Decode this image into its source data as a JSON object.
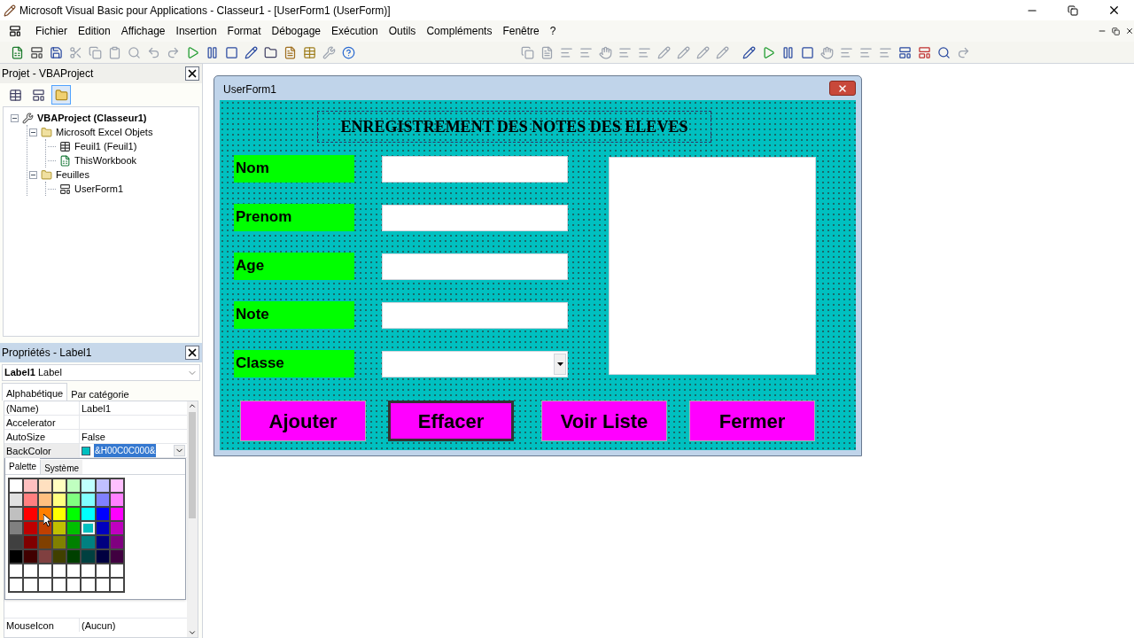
{
  "window": {
    "title": "Microsoft Visual Basic pour Applications - Classeur1 - [UserForm1 (UserForm)]"
  },
  "menu": [
    "Fichier",
    "Edition",
    "Affichage",
    "Insertion",
    "Format",
    "Débogage",
    "Exécution",
    "Outils",
    "Compléments",
    "Fenêtre",
    "?"
  ],
  "project_pane": {
    "title": "Projet - VBAProject",
    "tree": [
      {
        "label": "VBAProject (Classeur1)",
        "kind": "project",
        "expanded": true,
        "children": [
          {
            "label": "Microsoft Excel Objets",
            "kind": "folder",
            "expanded": true,
            "children": [
              {
                "label": "Feuil1 (Feuil1)",
                "kind": "sheet"
              },
              {
                "label": "ThisWorkbook",
                "kind": "workbook"
              }
            ]
          },
          {
            "label": "Feuilles",
            "kind": "folder",
            "expanded": true,
            "children": [
              {
                "label": "UserForm1",
                "kind": "form"
              }
            ]
          }
        ]
      }
    ]
  },
  "properties_pane": {
    "title": "Propriétés - Label1",
    "object": "Label1",
    "object_type": "Label",
    "tabs": [
      {
        "label": "Alphabétique",
        "selected": true
      },
      {
        "label": "Par catégorie",
        "selected": false
      }
    ],
    "rows": [
      {
        "name": "(Name)",
        "value": "Label1"
      },
      {
        "name": "Accelerator"
      },
      {
        "name": "AutoSize",
        "value": "False"
      },
      {
        "name": "BackColor",
        "value": "&H00C0C000&",
        "kind": "color",
        "color": "#00c0c0"
      }
    ],
    "rows_below": [
      {
        "name": "MouseIcon",
        "value": "(Aucun)"
      }
    ],
    "palette": {
      "tabs": [
        {
          "label": "Palette",
          "selected": true
        },
        {
          "label": "Système",
          "selected": false
        }
      ],
      "swatches": [
        {
          "color": "#ffffff",
          "selected": false
        },
        {
          "color": "#ffc0c0",
          "selected": false
        },
        {
          "color": "#ffe0c0",
          "selected": false
        },
        {
          "color": "#ffffc0",
          "selected": false
        },
        {
          "color": "#c0ffc0",
          "selected": false
        },
        {
          "color": "#c0ffff",
          "selected": false
        },
        {
          "color": "#c0c0ff",
          "selected": false
        },
        {
          "color": "#ffc0ff",
          "selected": false
        },
        {
          "color": "#e0e0e0",
          "selected": false
        },
        {
          "color": "#ff8080",
          "selected": false
        },
        {
          "color": "#ffc080",
          "selected": false
        },
        {
          "color": "#ffff80",
          "selected": false
        },
        {
          "color": "#80ff80",
          "selected": false
        },
        {
          "color": "#80ffff",
          "selected": false
        },
        {
          "color": "#8080ff",
          "selected": false
        },
        {
          "color": "#ff80ff",
          "selected": false
        },
        {
          "color": "#c0c0c0",
          "selected": false
        },
        {
          "color": "#ff0000",
          "selected": false
        },
        {
          "color": "#ff8000",
          "selected": false
        },
        {
          "color": "#ffff00",
          "selected": false
        },
        {
          "color": "#00ff00",
          "selected": false
        },
        {
          "color": "#00ffff",
          "selected": false
        },
        {
          "color": "#0000ff",
          "selected": false
        },
        {
          "color": "#ff00ff",
          "selected": false
        },
        {
          "color": "#808080",
          "selected": false
        },
        {
          "color": "#c00000",
          "selected": false
        },
        {
          "color": "#c04000",
          "selected": false
        },
        {
          "color": "#c0c000",
          "selected": false
        },
        {
          "color": "#00c000",
          "selected": false
        },
        {
          "color": "#00c0c0",
          "selected": true
        },
        {
          "color": "#0000c0",
          "selected": false
        },
        {
          "color": "#c000c0",
          "selected": false
        },
        {
          "color": "#404040",
          "selected": false
        },
        {
          "color": "#800000",
          "selected": false
        },
        {
          "color": "#804000",
          "selected": false
        },
        {
          "color": "#808000",
          "selected": false
        },
        {
          "color": "#008000",
          "selected": false
        },
        {
          "color": "#008080",
          "selected": false
        },
        {
          "color": "#000080",
          "selected": false
        },
        {
          "color": "#800080",
          "selected": false
        },
        {
          "color": "#000000",
          "selected": false
        },
        {
          "color": "#400000",
          "selected": false
        },
        {
          "color": "#804040",
          "selected": false
        },
        {
          "color": "#404000",
          "selected": false
        },
        {
          "color": "#004000",
          "selected": false
        },
        {
          "color": "#004040",
          "selected": false
        },
        {
          "color": "#000040",
          "selected": false
        },
        {
          "color": "#400040",
          "selected": false
        },
        {
          "color": "#ffffff",
          "selected": false
        },
        {
          "color": "#ffffff",
          "selected": false
        },
        {
          "color": "#ffffff",
          "selected": false
        },
        {
          "color": "#ffffff",
          "selected": false
        },
        {
          "color": "#ffffff",
          "selected": false
        },
        {
          "color": "#ffffff",
          "selected": false
        },
        {
          "color": "#ffffff",
          "selected": false
        },
        {
          "color": "#ffffff",
          "selected": false
        },
        {
          "color": "#ffffff",
          "selected": false
        },
        {
          "color": "#ffffff",
          "selected": false
        },
        {
          "color": "#ffffff",
          "selected": false
        },
        {
          "color": "#ffffff",
          "selected": false
        },
        {
          "color": "#ffffff",
          "selected": false
        },
        {
          "color": "#ffffff",
          "selected": false
        },
        {
          "color": "#ffffff",
          "selected": false
        },
        {
          "color": "#ffffff",
          "selected": false
        }
      ]
    }
  },
  "userform": {
    "title": "UserForm1",
    "heading": "ENREGISTREMENT DES NOTES DES ELEVES",
    "fields": [
      {
        "label": "Nom",
        "kind": "text"
      },
      {
        "label": "Prenom",
        "kind": "text"
      },
      {
        "label": "Age",
        "kind": "text"
      },
      {
        "label": "Note",
        "kind": "text"
      },
      {
        "label": "Classe",
        "kind": "combo"
      }
    ],
    "buttons": [
      {
        "label": "Ajouter",
        "focused": false
      },
      {
        "label": "Effacer",
        "focused": true
      },
      {
        "label": "Voir Liste",
        "focused": false
      },
      {
        "label": "Fermer",
        "focused": false
      }
    ]
  }
}
